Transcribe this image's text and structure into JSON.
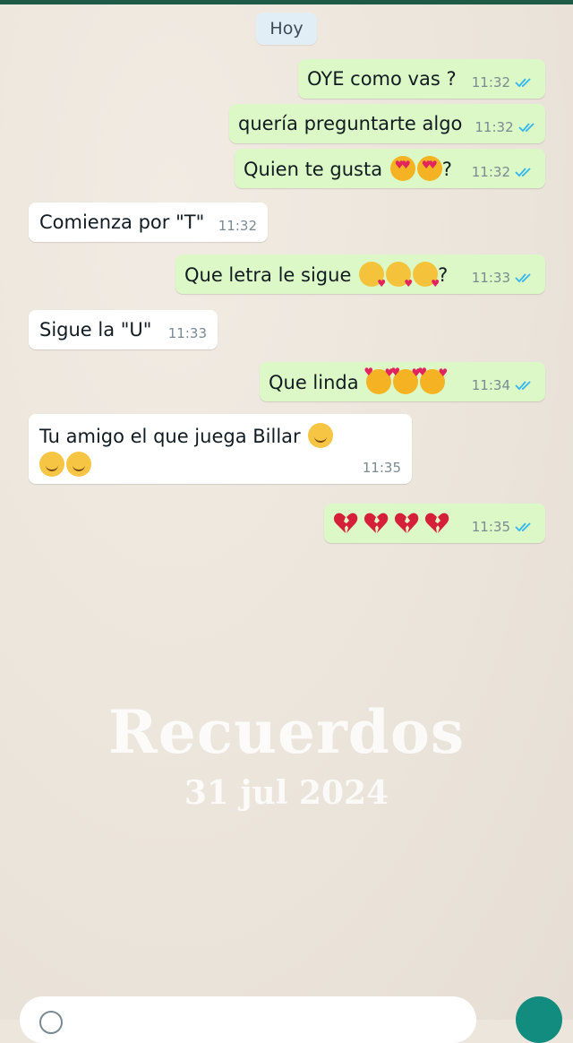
{
  "date_chip": "Hoy",
  "messages": [
    {
      "dir": "out",
      "text": "OYE como vas ?",
      "time": "11:32"
    },
    {
      "dir": "out",
      "text": "quería preguntarte algo",
      "time": "11:32"
    },
    {
      "dir": "out",
      "text": "Quien te gusta",
      "suffix": "?",
      "emoji": "smiling-face-with-heart-eyes x2",
      "time": "11:32"
    },
    {
      "dir": "in",
      "text": "Comienza por \"T\"",
      "time": "11:32"
    },
    {
      "dir": "out",
      "text": "Que letra le sigue",
      "suffix": "?",
      "emoji": "kissing-face x3",
      "time": "11:33"
    },
    {
      "dir": "in",
      "text": "Sigue la \"U\"",
      "time": "11:33"
    },
    {
      "dir": "out",
      "text": "Que linda",
      "emoji": "smiling-face-with-hearts x3",
      "time": "11:34"
    },
    {
      "dir": "in",
      "text": "Tu amigo el que juega Billar",
      "emoji": "smiling-face-with-smiling-eyes x3",
      "time": "11:35"
    },
    {
      "dir": "out",
      "text": "",
      "emoji": "broken-heart x4",
      "time": "11:35"
    }
  ],
  "watermark": {
    "title": "Recuerdos",
    "date": "31 jul 2024"
  },
  "colors": {
    "outgoing": "#dcf8c6",
    "incoming": "#ffffff",
    "read_ticks": "#34b7f1",
    "accent": "#128c7e"
  }
}
